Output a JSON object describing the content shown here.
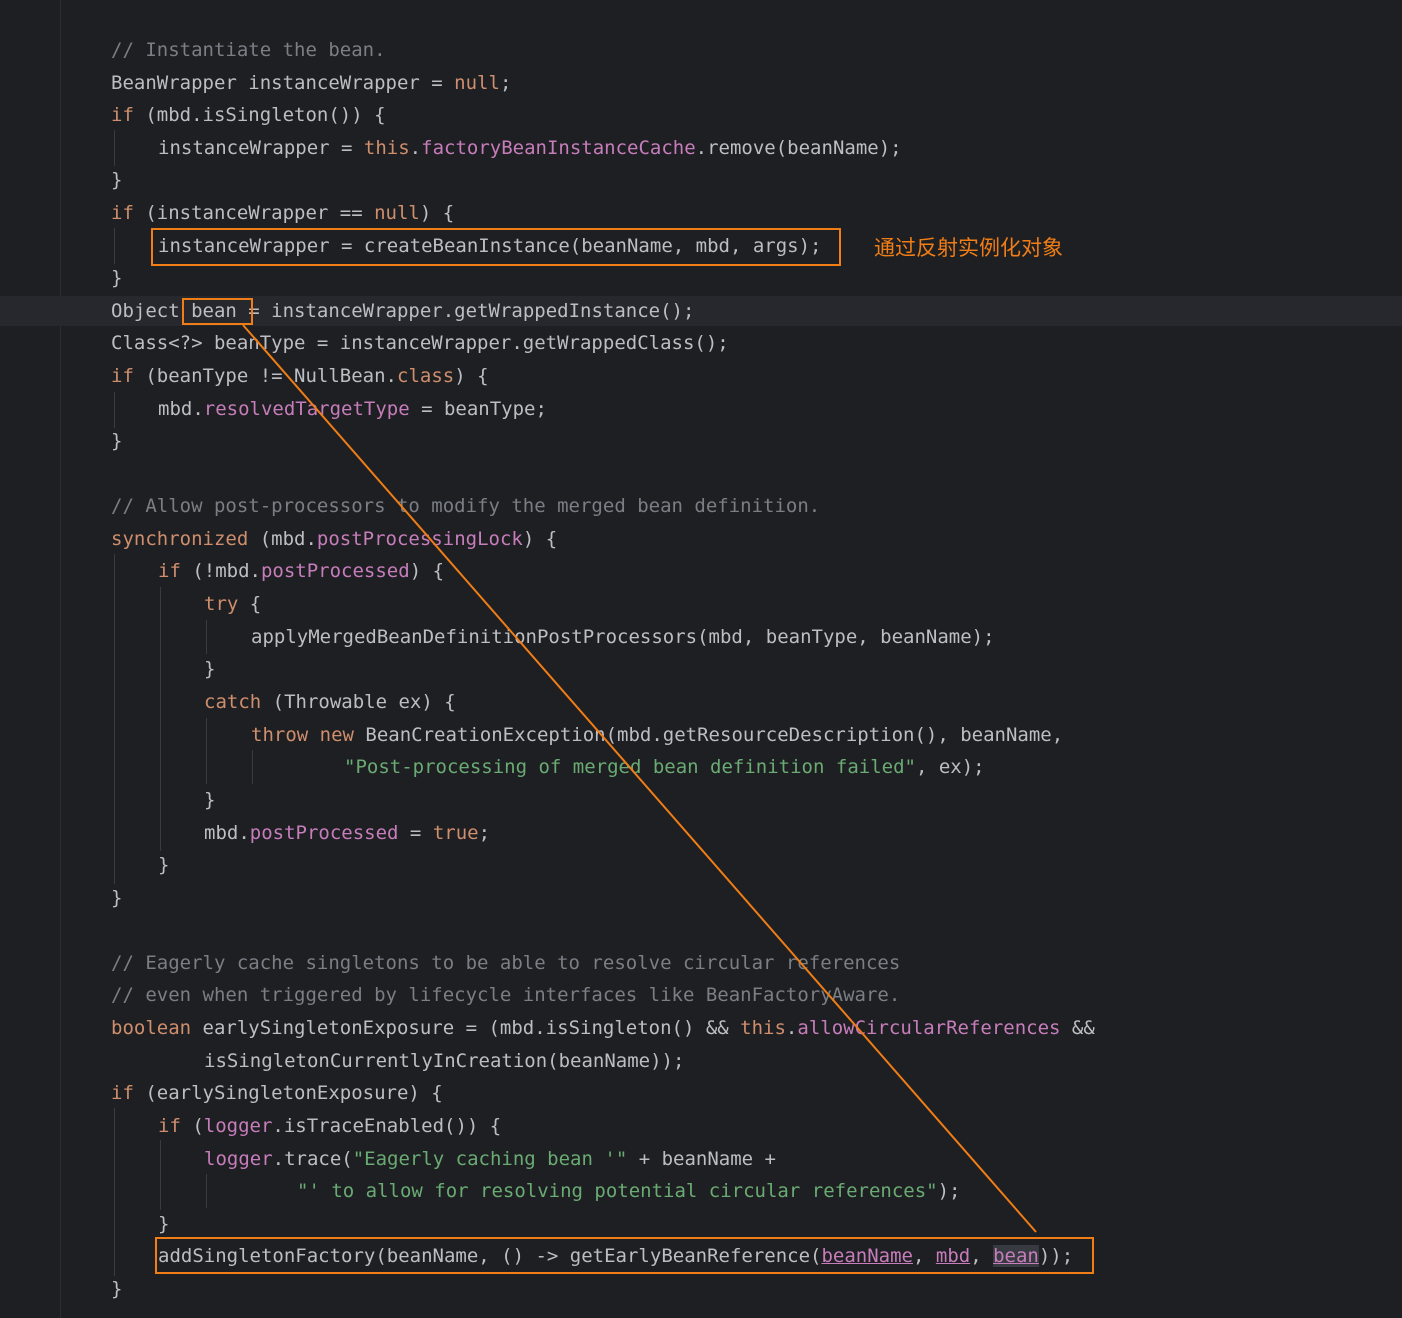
{
  "code": {
    "l1": "// Instantiate the bean.",
    "l2a": "BeanWrapper instanceWrapper = ",
    "l2b": "null",
    "l2c": ";",
    "l3a": "if",
    "l3b": " (mbd.isSingleton()) {",
    "l4a": "instanceWrapper = ",
    "l4b": "this",
    "l4c": ".",
    "l4d": "factoryBeanInstanceCache",
    "l4e": ".remove(beanName);",
    "l5": "}",
    "l6a": "if",
    "l6b": " (instanceWrapper == ",
    "l6c": "null",
    "l6d": ") {",
    "l7": "instanceWrapper = createBeanInstance(beanName, mbd, args);",
    "l8": "}",
    "l9a": "Object ",
    "l9b": "bean",
    "l9c": " = instanceWrapper.getWrappedInstance();",
    "l10": "Class<?> beanType = instanceWrapper.getWrappedClass();",
    "l11a": "if",
    "l11b": " (beanType != NullBean.",
    "l11c": "class",
    "l11d": ") {",
    "l12a": "mbd.",
    "l12b": "resolvedTargetType",
    "l12c": " = beanType;",
    "l13": "}",
    "l14": "// Allow post-processors to modify the merged bean definition.",
    "l15a": "synchronized",
    "l15b": " (mbd.",
    "l15c": "postProcessingLock",
    "l15d": ") {",
    "l16a": "if",
    "l16b": " (!mbd.",
    "l16c": "postProcessed",
    "l16d": ") {",
    "l17a": "try",
    "l17b": " {",
    "l18": "applyMergedBeanDefinitionPostProcessors(mbd, beanType, beanName);",
    "l19": "}",
    "l20a": "catch",
    "l20b": " (Throwable ex) {",
    "l21a": "throw new",
    "l21b": " BeanCreationException(mbd.getResourceDescription(), beanName,",
    "l22a": "\"Post-processing of merged bean definition failed\"",
    "l22b": ", ex);",
    "l23": "}",
    "l24a": "mbd.",
    "l24b": "postProcessed",
    "l24c": " = ",
    "l24d": "true",
    "l24e": ";",
    "l25": "}",
    "l26": "}",
    "l27": "// Eagerly cache singletons to be able to resolve circular references",
    "l28": "// even when triggered by lifecycle interfaces like BeanFactoryAware.",
    "l29a": "boolean",
    "l29b": " earlySingletonExposure = (mbd.isSingleton() && ",
    "l29c": "this",
    "l29d": ".",
    "l29e": "allowCircularReferences",
    "l29f": " &&",
    "l30": "isSingletonCurrentlyInCreation(beanName));",
    "l31a": "if",
    "l31b": " (earlySingletonExposure) {",
    "l32a": "if",
    "l32b": " (",
    "l32c": "logger",
    "l32d": ".isTraceEnabled()) {",
    "l33a": "logger",
    "l33b": ".trace(",
    "l33c": "\"Eagerly caching bean '\"",
    "l33d": " + beanName +",
    "l34a": "\"' to allow for resolving potential circular references\"",
    "l34b": ");",
    "l35": "}",
    "l36a": "addSingletonFactory(beanName, () -> getEarlyBeanReference(",
    "l36b": "beanName",
    "l36c": ", ",
    "l36d": "mbd",
    "l36e": ", ",
    "l36f": "bean",
    "l36g": "));",
    "l37": "}"
  },
  "annotation": {
    "note": "通过反射实例化对象",
    "color": "#f07d16"
  },
  "syntax_colors": {
    "background": "#1e1f22",
    "text": "#bcbec4",
    "keyword": "#cf8e6d",
    "field": "#c77dbb",
    "comment": "#7a7e85",
    "string": "#6aab73"
  }
}
